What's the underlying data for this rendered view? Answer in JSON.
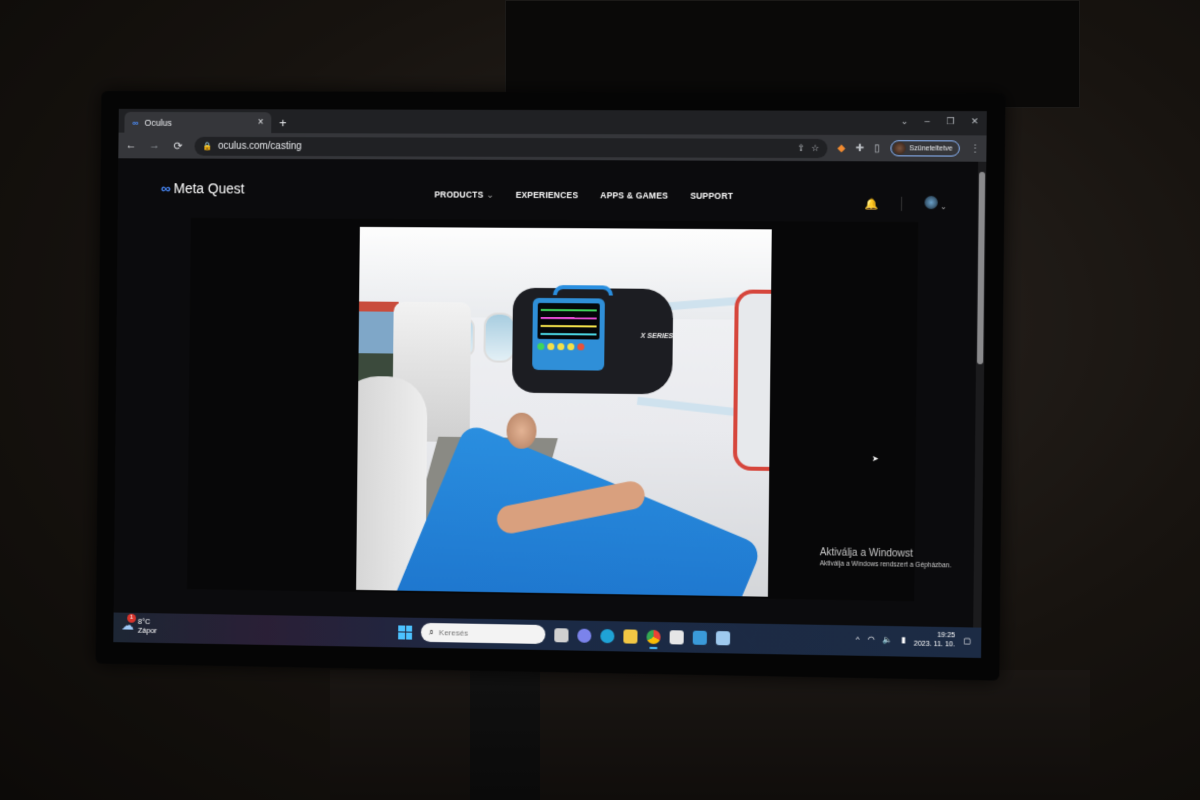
{
  "browser": {
    "tab": {
      "title": "Oculus",
      "favicon": "meta-infinity-icon"
    },
    "new_tab_symbol": "+",
    "close_tab_symbol": "×",
    "window_controls": {
      "tab_search": "⌄",
      "minimize": "–",
      "restore": "❐",
      "close": "✕"
    },
    "nav": {
      "back": "←",
      "forward": "→",
      "reload": "⟳"
    },
    "address": "oculus.com/casting",
    "profile_status": "Szüneteltetve",
    "toolbar_icons": [
      "share-icon",
      "star-icon",
      "fox-extension-icon",
      "puzzle-extensions-icon",
      "side-panel-icon"
    ]
  },
  "page": {
    "brand": {
      "logo_symbol": "∞",
      "name": "Meta Quest"
    },
    "nav": [
      {
        "label": "PRODUCTS",
        "has_dropdown": true
      },
      {
        "label": "EXPERIENCES",
        "has_dropdown": false
      },
      {
        "label": "APPS & GAMES",
        "has_dropdown": false
      },
      {
        "label": "SUPPORT",
        "has_dropdown": false
      }
    ],
    "dropdown_chevron": "⌄",
    "header_icons": {
      "notifications": "🔔",
      "account_chevron": "⌄"
    },
    "casting": {
      "description": "VR air-ambulance scene: patient on stretcher with defibrillator monitor",
      "device_label": "X SERIES"
    },
    "windows_watermark": {
      "title": "Aktiválja a Windowst",
      "subtitle": "Aktiválja a Windows rendszert a Gépházban."
    }
  },
  "taskbar": {
    "weather": {
      "temp": "8°C",
      "condition": "Zápor",
      "badge": "1"
    },
    "search_placeholder": "Keresés",
    "search_icon": "⌕",
    "apps": [
      {
        "name": "task-view",
        "color": "#d0d0d0"
      },
      {
        "name": "teams-chat",
        "color": "#7b83eb"
      },
      {
        "name": "edge",
        "color": "#1fa3d6"
      },
      {
        "name": "file-explorer",
        "color": "#f2c744"
      },
      {
        "name": "chrome",
        "color": "#34a853",
        "active": true
      },
      {
        "name": "store",
        "color": "#e6e6e6"
      },
      {
        "name": "mail",
        "color": "#3a9ad9"
      },
      {
        "name": "photos",
        "color": "#9ec9ee"
      }
    ],
    "tray": {
      "overflow": "^",
      "wifi": "◠",
      "volume": "🔈",
      "battery": "▮",
      "time": "19:25",
      "date": "2023. 11. 10.",
      "notification": "▢"
    }
  }
}
